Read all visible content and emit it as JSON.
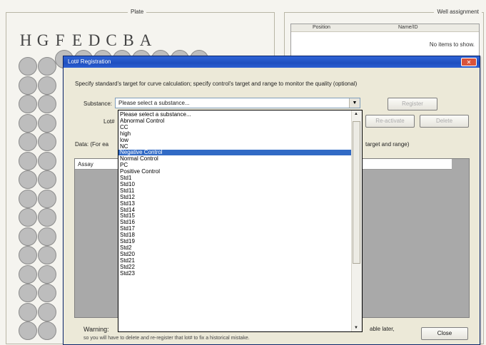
{
  "plate": {
    "title": "Plate",
    "columns": [
      "H",
      "G",
      "F",
      "E",
      "D",
      "C",
      "B",
      "A"
    ]
  },
  "well_assignment": {
    "title": "Well assignment",
    "headers": [
      "Position",
      "Name/ID"
    ],
    "empty_text": "No items to show."
  },
  "dialog": {
    "title": "Lot# Registration",
    "instructions": "Specify standard's target for curve calculation; specify control's target and range to monitor the quality (optional)",
    "substance_label": "Substance:",
    "lot_label": "Lot#",
    "data_label": "Data: (For ea",
    "data_suffix": "target and range)",
    "grid_header": "Assay",
    "register_button": "Register",
    "reactivate_button": "Re-activate",
    "delete_button": "Delete",
    "warning_label": "Warning:",
    "warning_line1_end": "able later,",
    "warning_line2": "so you will have to delete and re-register that lot# to fix a historical mistake.",
    "close_button": "Close",
    "substance_selected": "Please select a substance..."
  },
  "substance_options": [
    {
      "label": "Please select a substance..."
    },
    {
      "label": "Abnormal Control"
    },
    {
      "label": "CC"
    },
    {
      "label": "high"
    },
    {
      "label": "low"
    },
    {
      "label": "NC"
    },
    {
      "label": "Negative Control",
      "selected": true
    },
    {
      "label": "Normal Control"
    },
    {
      "label": "PC"
    },
    {
      "label": "Positive Control"
    },
    {
      "label": "Std1"
    },
    {
      "label": "Std10"
    },
    {
      "label": "Std11"
    },
    {
      "label": "Std12"
    },
    {
      "label": "Std13"
    },
    {
      "label": "Std14"
    },
    {
      "label": "Std15"
    },
    {
      "label": "Std16"
    },
    {
      "label": "Std17"
    },
    {
      "label": "Std18"
    },
    {
      "label": "Std19"
    },
    {
      "label": "Std2"
    },
    {
      "label": "Std20"
    },
    {
      "label": "Std21"
    },
    {
      "label": "Std22"
    },
    {
      "label": "Std23"
    }
  ],
  "colors": {
    "title_bar": "#1f4fbf",
    "selection": "#316ac5",
    "well": "#bdbdbd"
  }
}
